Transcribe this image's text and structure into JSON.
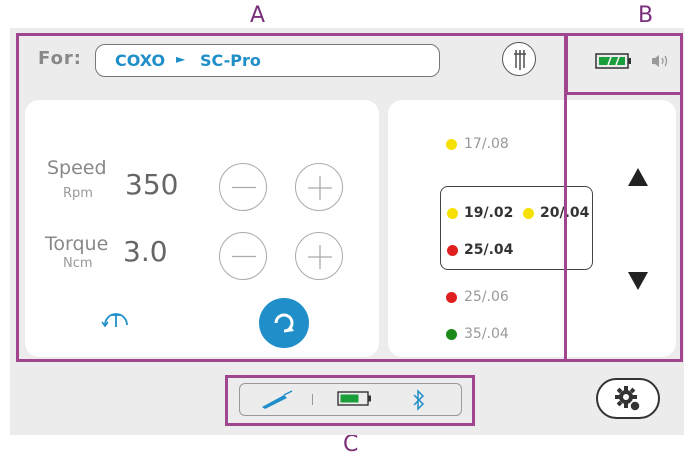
{
  "callouts": {
    "a": "A",
    "b": "B",
    "c": "C"
  },
  "header": {
    "for_label": "For:",
    "brand": "COXO",
    "arrow": "►",
    "model": "SC-Pro"
  },
  "settings": {
    "speed_label": "Speed",
    "speed_unit": "Rpm",
    "speed_value": "350",
    "torque_label": "Torque",
    "torque_unit": "Ncm",
    "torque_value": "3.0"
  },
  "file_list": {
    "above": {
      "label": "17/.08",
      "color": "#f5e000"
    },
    "selected_row1": [
      {
        "label": "19/.02",
        "color": "#f5e000"
      },
      {
        "label": "20/.04",
        "color": "#f5e000"
      }
    ],
    "selected_row2": {
      "label": "25/.04",
      "color": "#e02020"
    },
    "below1": {
      "label": "25/.06",
      "color": "#e02020"
    },
    "below2": {
      "label": "35/.04",
      "color": "#1a8a1a"
    }
  },
  "colors": {
    "accent": "#1f8ec9",
    "callout": "#a0468f",
    "battery": "#1a9e3a"
  },
  "icons": [
    "files-icon",
    "battery-icon",
    "volume-icon",
    "handpiece-icon",
    "bluetooth-icon",
    "settings-gear-icon",
    "torque-reverse-icon",
    "rotation-icon"
  ]
}
